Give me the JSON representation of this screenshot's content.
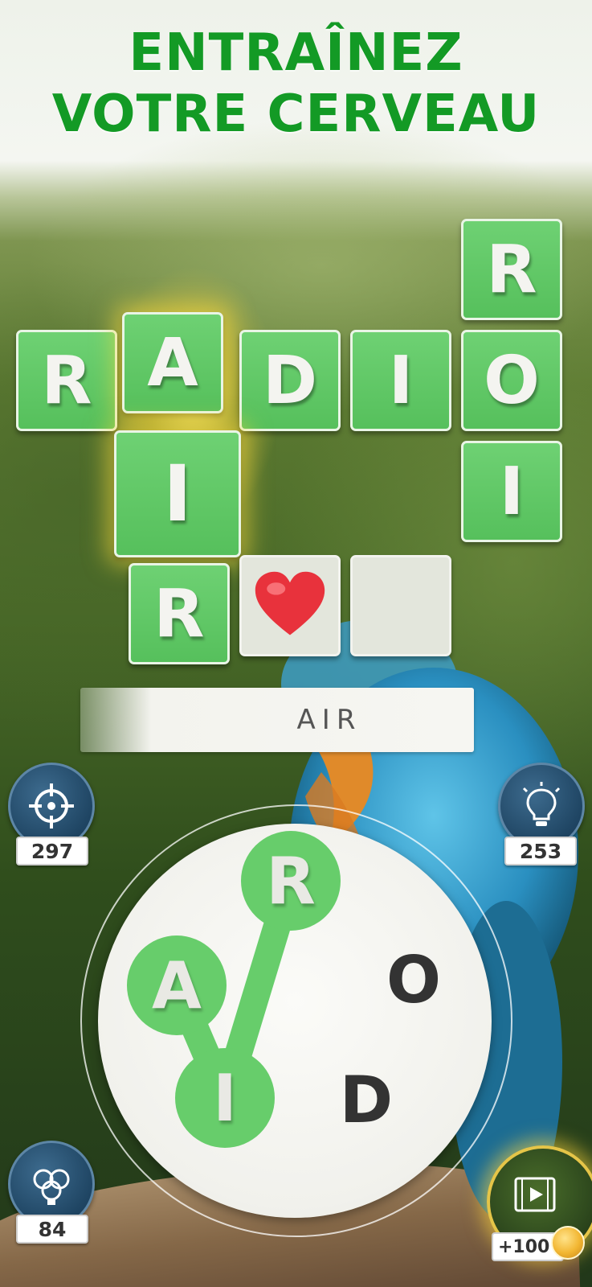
{
  "header": {
    "title_line1": "ENTRAÎNEZ",
    "title_line2": "VOTRE CERVEAU"
  },
  "grid": {
    "radio": [
      "R",
      "A",
      "D",
      "I",
      "O"
    ],
    "roi": [
      "R",
      "O",
      "I"
    ],
    "air": [
      "A",
      "I",
      "R"
    ],
    "pending_cells": [
      "heart",
      "empty"
    ]
  },
  "current_word": "AIR",
  "tools": {
    "target": {
      "icon": "crosshair-icon",
      "count": "297"
    },
    "hint": {
      "icon": "lightbulb-icon",
      "count": "253"
    },
    "multi_hint": {
      "icon": "multi-lightbulb-icon",
      "count": "84"
    },
    "video": {
      "icon": "video-play-icon",
      "reward": "+100",
      "reward_icon": "coin-icon"
    }
  },
  "wheel": {
    "letters": [
      "R",
      "A",
      "O",
      "I",
      "D"
    ],
    "selected_sequence": [
      "A",
      "I",
      "R"
    ]
  },
  "colors": {
    "title": "#139a25",
    "tile": "#5cc462",
    "selected_letter": "#67cd6b",
    "tool_button": "#1f4563"
  }
}
